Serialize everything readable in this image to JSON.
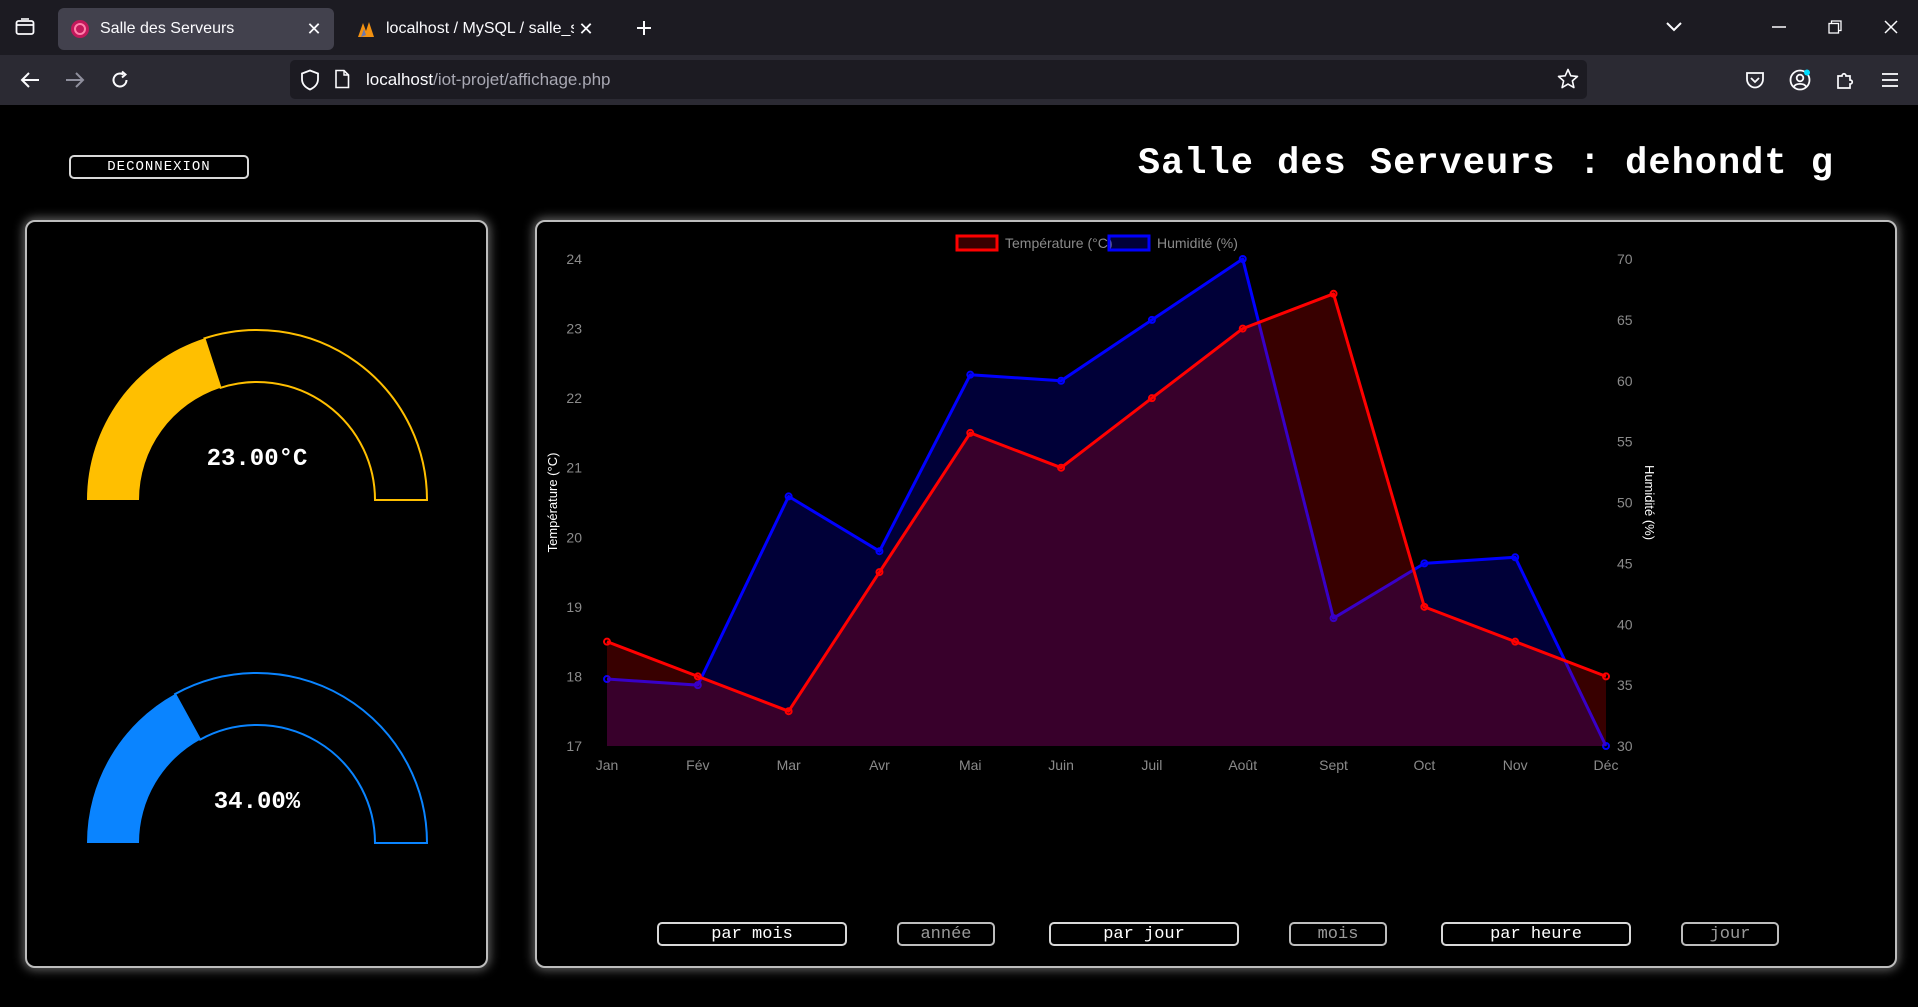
{
  "browser": {
    "tabs": [
      {
        "title": "Salle des Serveurs",
        "active": true
      },
      {
        "title": "localhost / MySQL / salle_serveur",
        "active": false
      }
    ],
    "url_host": "localhost",
    "url_path": "/iot-projet/affichage.php"
  },
  "header": {
    "logout_label": "DECONNEXION",
    "title": "Salle des Serveurs : dehondt g"
  },
  "gauges": {
    "temperature": {
      "text": "23.00°C",
      "fraction": 0.4,
      "color": "#ffbf00"
    },
    "humidity": {
      "text": "34.00%",
      "fraction": 0.34,
      "color": "#0a84ff"
    }
  },
  "range_buttons": [
    {
      "label": "par mois",
      "sub": false
    },
    {
      "label": "année",
      "sub": true
    },
    {
      "label": "par jour",
      "sub": false
    },
    {
      "label": "mois",
      "sub": true
    },
    {
      "label": "par heure",
      "sub": false
    },
    {
      "label": "jour",
      "sub": true
    }
  ],
  "chart_data": {
    "type": "line",
    "categories": [
      "Jan",
      "Fév",
      "Mar",
      "Avr",
      "Mai",
      "Juin",
      "Juil",
      "Août",
      "Sept",
      "Oct",
      "Nov",
      "Déc"
    ],
    "series": [
      {
        "name": "Température (°C)",
        "axis": "left",
        "color": "#ff0000",
        "fill": "rgba(255,0,0,0.22)",
        "values": [
          18.5,
          18.0,
          17.5,
          19.5,
          21.5,
          21.0,
          22.0,
          23.0,
          23.5,
          19.0,
          18.5,
          18.0
        ]
      },
      {
        "name": "Humidité (%)",
        "axis": "right",
        "color": "#0000ff",
        "fill": "rgba(0,0,255,0.22)",
        "values": [
          35.5,
          35.0,
          50.5,
          46.0,
          60.5,
          60.0,
          65.0,
          70.0,
          40.5,
          45.0,
          45.5,
          30.0
        ]
      }
    ],
    "y_left": {
      "label": "Température (°C)",
      "min": 17,
      "max": 24,
      "ticks": [
        "17",
        "18",
        "19",
        "20",
        "21",
        "22",
        "23",
        "24"
      ]
    },
    "y_right": {
      "label": "Humidité (%)",
      "min": 30,
      "max": 70,
      "ticks": [
        "30",
        "35",
        "40",
        "45",
        "50",
        "55",
        "60",
        "65",
        "70"
      ]
    },
    "legend_position": "top",
    "grid": false
  }
}
